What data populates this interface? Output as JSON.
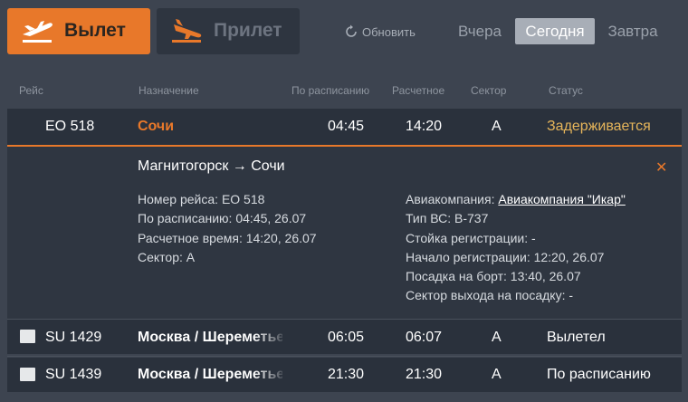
{
  "tabs": {
    "depart": "Вылет",
    "arrive": "Прилет"
  },
  "refresh": "Обновить",
  "days": {
    "yesterday": "Вчера",
    "today": "Сегодня",
    "tomorrow": "Завтра",
    "active": "today"
  },
  "columns": {
    "flight": "Рейс",
    "destination": "Назначение",
    "scheduled": "По расписанию",
    "estimated": "Расчетное",
    "sector": "Сектор",
    "status": "Статус"
  },
  "flights": [
    {
      "flight": "EO 518",
      "destination": "Сочи",
      "scheduled": "04:45",
      "estimated": "14:20",
      "sector": "A",
      "status": "Задерживается",
      "expanded": true,
      "details": {
        "route": "Магнитогорск → Сочи",
        "left": [
          "Номер рейса: EO 518",
          "По расписанию: 04:45, 26.07",
          "Расчетное время: 14:20, 26.07",
          "Сектор: A"
        ],
        "airline_label": "Авиакомпания:",
        "airline_link": "Авиакомпания \"Икар\"",
        "right": [
          "Тип ВС: B-737",
          "Стойка регистрации: -",
          "Начало регистрации: 12:20, 26.07",
          "Посадка на борт: 13:40, 26.07",
          "Сектор выхода на посадку: -"
        ]
      }
    },
    {
      "flight": "SU 1429",
      "destination": "Москва / Шереметьево",
      "scheduled": "06:05",
      "estimated": "06:07",
      "sector": "A",
      "status": "Вылетел"
    },
    {
      "flight": "SU 1439",
      "destination": "Москва / Шереметьево",
      "scheduled": "21:30",
      "estimated": "21:30",
      "sector": "A",
      "status": "По расписанию"
    }
  ],
  "colors": {
    "accent": "#e8782a",
    "background": "#3d4450",
    "row": "#2a313c",
    "status_delayed": "#e6b55a"
  },
  "icons": [
    "plane-takeoff-icon",
    "plane-landing-icon",
    "refresh-icon",
    "close-icon",
    "airline-logo-icon"
  ]
}
